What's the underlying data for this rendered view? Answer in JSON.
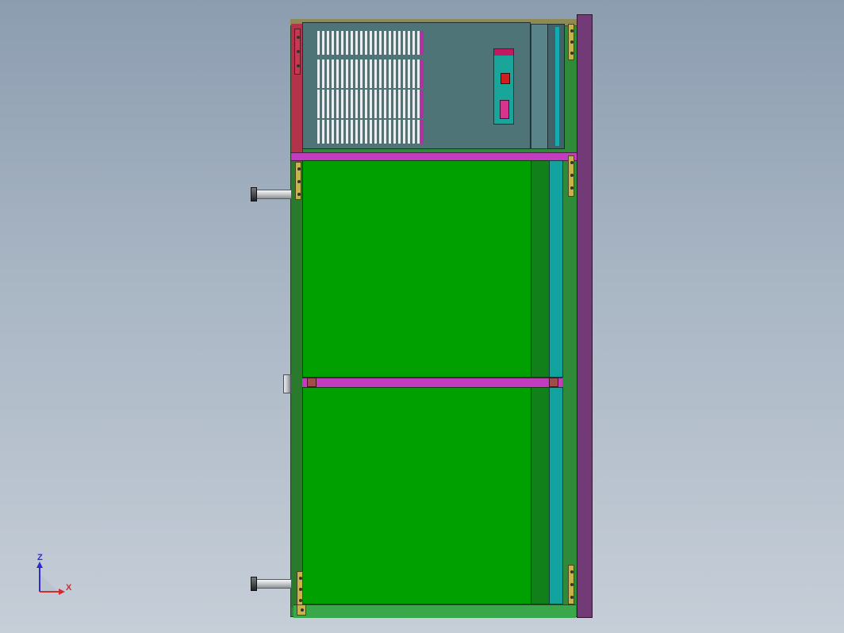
{
  "viewport": {
    "background_top": "#8c9db0",
    "background_bottom": "#c6ced8"
  },
  "model": {
    "colors": {
      "drawer_front": "#00a000",
      "divider": "#c33cbf",
      "side_panel": "#733a78",
      "computer_case": "#4f7478",
      "bracket": "#c7b24b",
      "left_bracket_red": "#b3344a"
    },
    "computer_unit": {
      "vent_rows": 4,
      "power_switch_color": "#d01e1e"
    },
    "drawers": [
      "upper",
      "lower"
    ]
  },
  "axis_triad": {
    "z_label": "Z",
    "x_label": "X",
    "z_color": "#2b2bd6",
    "x_color": "#d62b2b"
  }
}
